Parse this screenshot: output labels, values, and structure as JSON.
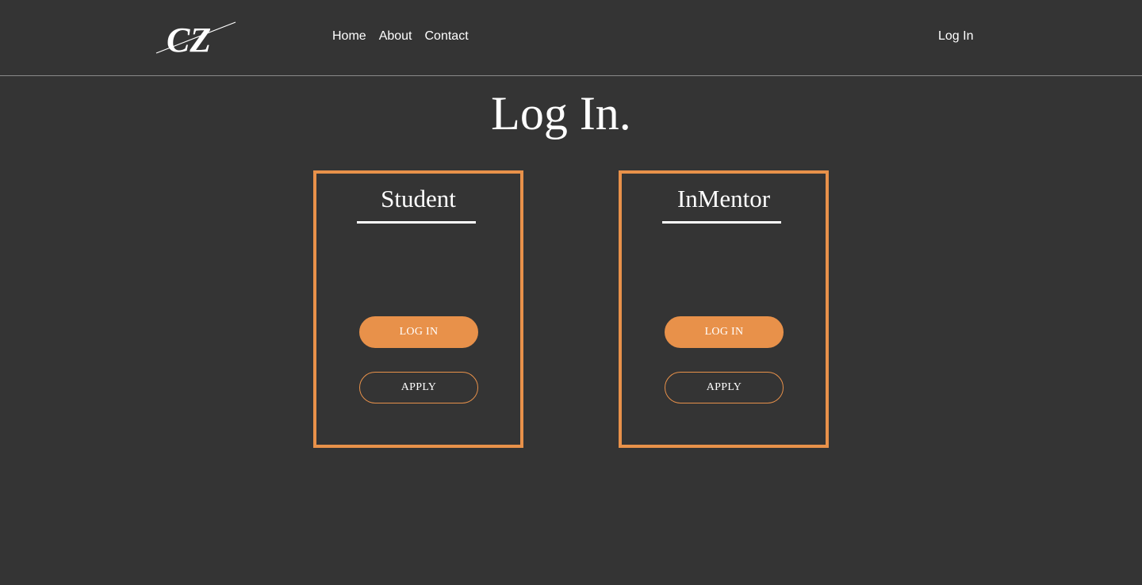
{
  "header": {
    "logo_text": "CZ",
    "nav": [
      {
        "label": "Home"
      },
      {
        "label": "About"
      },
      {
        "label": "Contact"
      }
    ],
    "login_label": "Log In"
  },
  "main": {
    "title": "Log In.",
    "cards": [
      {
        "title": "Student",
        "login_label": "LOG IN",
        "apply_label": "APPLY"
      },
      {
        "title": "InMentor",
        "login_label": "LOG IN",
        "apply_label": "APPLY"
      }
    ]
  },
  "colors": {
    "background": "#343434",
    "accent": "#e8914a",
    "text": "#ffffff"
  }
}
